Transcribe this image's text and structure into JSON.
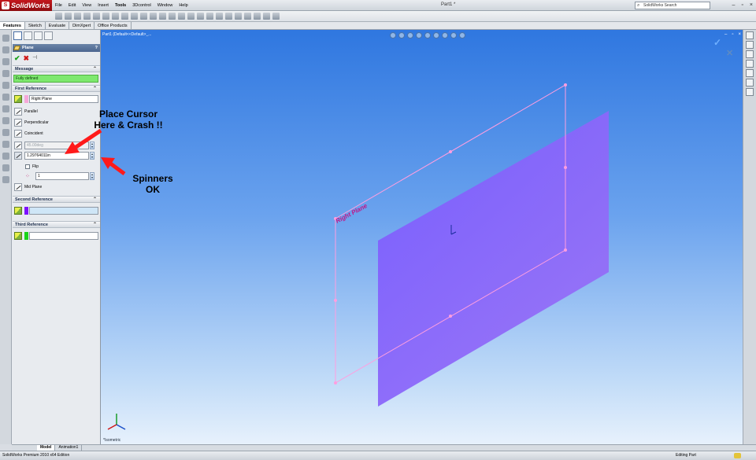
{
  "app": {
    "brand": "SolidWorks",
    "document_title": "Part1 *",
    "search_placeholder": "SolidWorks Search",
    "menu": [
      "File",
      "Edit",
      "View",
      "Insert",
      "Tools",
      "3Dcontrol",
      "Window",
      "Help"
    ]
  },
  "command_tabs": [
    "Features",
    "Sketch",
    "Evaluate",
    "DimXpert",
    "Office Products"
  ],
  "property_manager": {
    "title": "Plane",
    "help": "?",
    "sections": {
      "message": "Message",
      "first_reference": "First Reference",
      "second_reference": "Second Reference",
      "third_reference": "Third Reference"
    },
    "message_text": "Fully defined",
    "first_ref_selection": "Right Plane",
    "options": {
      "parallel": "Parallel",
      "perpendicular": "Perpendicular",
      "coincident": "Coincident"
    },
    "angle_value": "45.00deg",
    "distance_value": "1.29764011in",
    "flip_label": "Flip",
    "instances_value": "1",
    "mid_plane": "Mid Plane"
  },
  "viewport": {
    "tree_label": "Part1 (Default<<Default>_...",
    "plane_label": "Right Plane",
    "view_label": "*Isometric"
  },
  "bottom_tabs": [
    "Model",
    "Animation1"
  ],
  "status": {
    "left": "SolidWorks Premium 2010 x64 Edition",
    "right": "Editing Part"
  },
  "annotations": {
    "crash": [
      "Place Cursor",
      "Here & Crash !!"
    ],
    "spinners": [
      "Spinners",
      "OK"
    ]
  },
  "colors": {
    "viewport_top": "#2f77e0",
    "viewport_bottom": "#e7f1fc",
    "plane_fill": "#8e6dff",
    "plane_outline": "#ff9ee0",
    "message_ok": "#7ee86e",
    "arrow": "#ff1a1a"
  }
}
